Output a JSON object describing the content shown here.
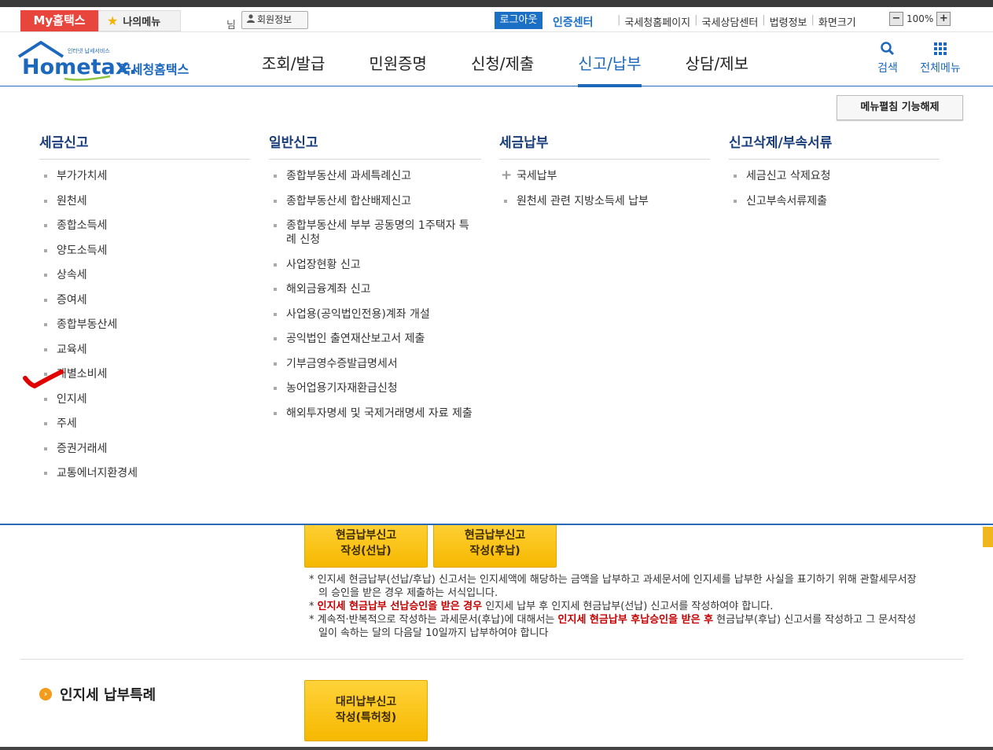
{
  "utility": {
    "my_hometax": "My홈택스",
    "my_menu": "나의메뉴",
    "nim": "님",
    "member_info": "회원정보",
    "logout": "로그아웃",
    "cert_center": "인증센터",
    "links": [
      "국세청홈페이지",
      "국세상담센터",
      "법령정보",
      "화면크기"
    ],
    "zoom_value": "100%",
    "zoom_minus": "−",
    "zoom_plus": "+"
  },
  "header": {
    "logo_small": "인터넷 납세서비스",
    "logo_main": "Hometax.",
    "logo_kr": "국세청홈택스",
    "nav": [
      "조회/발급",
      "민원증명",
      "신청/제출",
      "신고/납부",
      "상담/제보"
    ],
    "active_nav": "신고/납부",
    "search": "검색",
    "all_menu": "전체메뉴"
  },
  "mega": {
    "fold_button": "메뉴펼침 기능해제",
    "columns": [
      {
        "title": "세금신고",
        "items": [
          "부가가치세",
          "원천세",
          "종합소득세",
          "양도소득세",
          "상속세",
          "증여세",
          "종합부동산세",
          "교육세",
          "개별소비세",
          "인지세",
          "주세",
          "증권거래세",
          "교통에너지환경세"
        ]
      },
      {
        "title": "일반신고",
        "items": [
          "종합부동산세 과세특례신고",
          "종합부동산세 합산배제신고",
          "종합부동산세 부부 공동명의 1주택자 특례 신청",
          "사업장현황 신고",
          "해외금융계좌 신고",
          "사업용(공익법인전용)계좌 개설",
          "공익법인 출연재산보고서 제출",
          "기부금영수증발급명세서",
          "농어업용기자재환급신청",
          "해외투자명세 및 국제거래명세 자료 제출"
        ]
      },
      {
        "title": "세금납부",
        "items": [
          "국세납부",
          "원천세 관련 지방소득세 납부"
        ]
      },
      {
        "title": "신고삭제/부속서류",
        "items": [
          "세금신고 삭제요청",
          "신고부속서류제출"
        ]
      }
    ]
  },
  "content": {
    "btn_prepay_line1": "현금납부신고",
    "btn_prepay_line2": "작성(선납)",
    "btn_postpay_line1": "현금납부신고",
    "btn_postpay_line2": "작성(후납)",
    "note1": "인지세 현금납부(선납/후납) 신고서는 인지세액에 해당하는 금액을 납부하고 과세문서에 인지세를 납부한 사실을 표기하기 위해 관할세무서장의 승인을 받은 경우 제출하는 서식입니다.",
    "note2_red": "인지세 현금납부 선납승인을 받은 경우",
    "note2_rest": " 인지세 납부 후 인지세 현금납부(선납) 신고서를 작성하여야 합니다.",
    "note3_a": "계속적·반복적으로 작성하는 과세문서(후납)에 대해서는 ",
    "note3_red": "인지세 현금납부 후납승인을 받은 후",
    "note3_b": " 현금납부(후납) 신고서를 작성하고 그 문서작성일이 속하는 달의 다음달 10일까지 납부하여야 합니다",
    "section_title": "인지세 납부특례",
    "btn_proxy_line1": "대리납부신고",
    "btn_proxy_line2": "작성(특허청)"
  },
  "colors": {
    "accent": "#1c68bc",
    "my_tab": "#e8453c",
    "button_yellow": "#f6b800",
    "red_text": "#c40000",
    "checkmark": "#e00000"
  }
}
